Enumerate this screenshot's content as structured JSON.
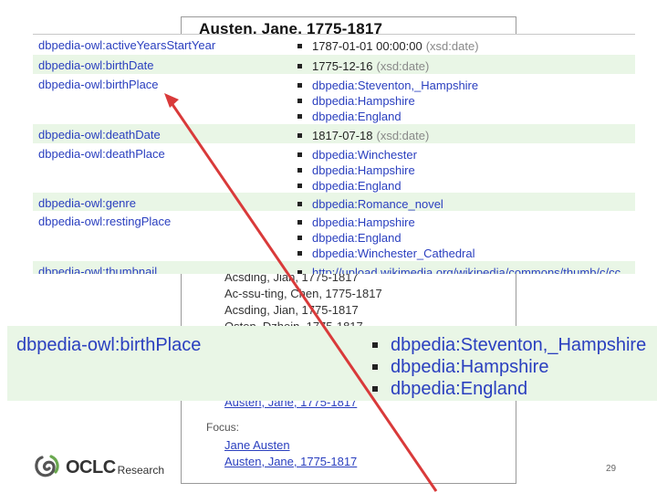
{
  "background_record": {
    "title": "Austen, Jane, 1775-1817",
    "variant_names": [
      "Acsding, Jian, 1775-1817",
      "Ac-ssu-ting, Chen, 1775-1817",
      "Acsding, Jian, 1775-1817",
      "Osten, Dzhein, 1775-1817"
    ],
    "linked_name": "Austen, Jane, 1775-1817",
    "focus_label": "Focus:",
    "focus_links": [
      "Jane Austen",
      "Austen, Jane, 1775-1817"
    ]
  },
  "properties": [
    {
      "key": "dbpedia-owl:activeYearsStartYear",
      "values": [
        {
          "text": "1787-01-01 00:00:00",
          "dtype": "(xsd:date)"
        }
      ]
    },
    {
      "key": "dbpedia-owl:birthDate",
      "values": [
        {
          "text": "1775-12-16",
          "dtype": "(xsd:date)"
        }
      ]
    },
    {
      "key": "dbpedia-owl:birthPlace",
      "values": [
        {
          "text": "dbpedia:Steventon,_Hampshire"
        },
        {
          "text": "dbpedia:Hampshire"
        },
        {
          "text": "dbpedia:England"
        }
      ]
    },
    {
      "key": "dbpedia-owl:deathDate",
      "values": [
        {
          "text": "1817-07-18",
          "dtype": "(xsd:date)"
        }
      ]
    },
    {
      "key": "dbpedia-owl:deathPlace",
      "values": [
        {
          "text": "dbpedia:Winchester"
        },
        {
          "text": "dbpedia:Hampshire"
        },
        {
          "text": "dbpedia:England"
        }
      ]
    },
    {
      "key": "dbpedia-owl:genre",
      "values": [
        {
          "text": "dbpedia:Romance_novel"
        }
      ]
    },
    {
      "key": "dbpedia-owl:restingPlace",
      "values": [
        {
          "text": "dbpedia:Hampshire"
        },
        {
          "text": "dbpedia:England"
        },
        {
          "text": "dbpedia:Winchester_Cathedral"
        }
      ]
    },
    {
      "key": "dbpedia-owl:thumbnail",
      "values": [
        {
          "text": "http://upload.wikimedia.org/wikipedia/commons/thumb/c/cc"
        }
      ]
    }
  ],
  "zoom": {
    "key": "dbpedia-owl:birthPlace",
    "values": [
      "dbpedia:Steventon,_Hampshire",
      "dbpedia:Hampshire",
      "dbpedia:England"
    ]
  },
  "logo": {
    "name": "OCLC",
    "sub": "Research"
  },
  "page_number": "29",
  "colors": {
    "link": "#2a3fbf",
    "row_alt": "#e9f6e6",
    "arrow": "#d93a3a"
  }
}
